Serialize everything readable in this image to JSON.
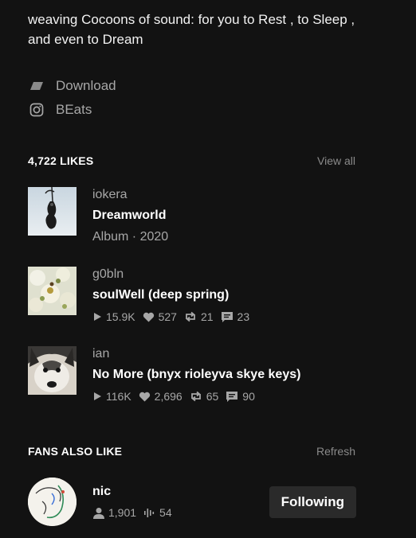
{
  "bio": "weaving Cocoons of sound: for you to Rest , to Sleep , and even to Dream",
  "links": [
    {
      "label": "Download",
      "icon": "link-tag-icon"
    },
    {
      "label": "BEats",
      "icon": "instagram-icon"
    }
  ],
  "likes": {
    "title": "4,722 LIKES",
    "action": "View all",
    "items": [
      {
        "artist": "iokera",
        "title": "Dreamworld",
        "sub": "Album · 2020"
      },
      {
        "artist": "g0bln",
        "title": "soulWell (deep spring)",
        "plays": "15.9K",
        "likes": "527",
        "reposts": "21",
        "comments": "23"
      },
      {
        "artist": "ian",
        "title": "No More (bnyx rioleyva skye keys)",
        "plays": "116K",
        "likes": "2,696",
        "reposts": "65",
        "comments": "90"
      }
    ]
  },
  "fans": {
    "title": "FANS ALSO LIKE",
    "action": "Refresh",
    "items": [
      {
        "name": "nic",
        "followers": "1,901",
        "tracks": "54",
        "button": "Following"
      }
    ]
  },
  "colors": {
    "background": "#121212",
    "text": "#ffffff",
    "muted": "#a7a7a7",
    "button": "#2a2a2a"
  }
}
